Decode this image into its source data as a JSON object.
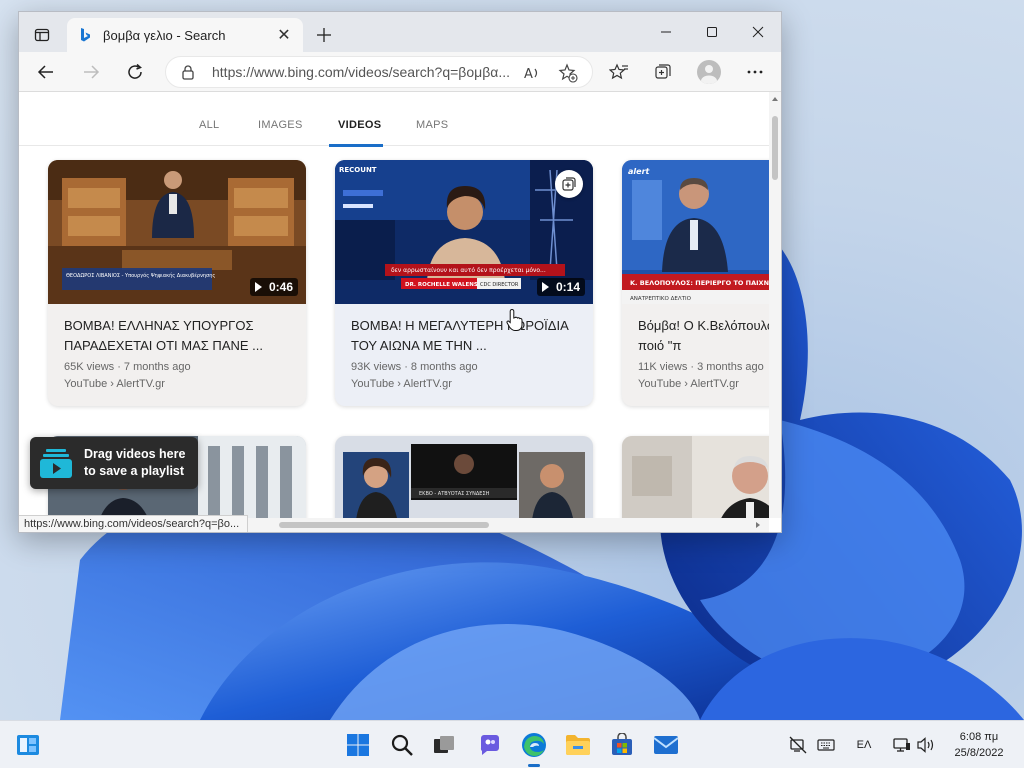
{
  "tab": {
    "title": "βομβα γελιο - Search",
    "close_glyph": "✕"
  },
  "toolbar": {
    "url": "https://www.bing.com/videos/search?q=βομβα..."
  },
  "scope_tabs": [
    {
      "label": "ALL"
    },
    {
      "label": "IMAGES"
    },
    {
      "label": "VIDEOS",
      "active": true
    },
    {
      "label": "MAPS"
    }
  ],
  "cards": [
    {
      "duration": "0:46",
      "title": "ΒΟΜΒΑ! ΕΛΛΗΝΑΣ ΥΠΟΥΡΓΟΣ ΠΑΡΑΔΕΧΕΤΑΙ ΟΤΙ ΜΑΣ ΠΑΝΕ ...",
      "views": "65K views · 7 months ago",
      "source": "YouTube › AlertTV.gr"
    },
    {
      "duration": "0:14",
      "title": "ΒΟΜΒΑ! Η ΜΕΓΑΛΥΤΕΡΗ ΚΩΡΟΪΔΙΑ ΤΟΥ ΑΙΩΝΑ ΜΕ ΤΗΝ ...",
      "views": "93K views · 8 months ago",
      "source": "YouTube › AlertTV.gr"
    },
    {
      "title": "Βόμβα! Ο Κ.Βελόπουλος αποκαλύπτει ποιό \"π",
      "views": "11K views · 3 months ago",
      "source": "YouTube › AlertTV.gr"
    }
  ],
  "thumb_captions": {
    "c1": "ΘΕΟΔΩΡΟΣ ΛΙΒΑΝΙΟΣ - Υπουργός Ψηφιακής Διακυβέρνησης",
    "c2_ticker": "δεν αρρωσταίνουν και αυτό δεν προέρχεται μόνο...",
    "c2_name": "DR. ROCHELLE WALENSKY",
    "c2_role": "CDC DIRECTOR",
    "c2_brand": "RECOUNT",
    "c3_brand": "alert",
    "c3_banner": "Κ. ΒΕΛΟΠΟΥΛΟΣ: ΠΕΡΙΕΡΓΟ ΤΟ ΠΑΙΧΝΙΔΙ ΠΟ",
    "c3_sub": "ΑΝΑΤΡΕΠΤΙΚΟ ΔΕΛΤΙΟ",
    "c5_strip": "ΕΚΒΟ - ΑΤΒΥΟΤΑΣ ΣΥΝΔΕΣΗ"
  },
  "playlist_hint": {
    "line1": "Drag videos here",
    "line2": "to save a playlist"
  },
  "status_bar": {
    "url": "https://www.bing.com/videos/search?q=βο..."
  },
  "taskbar": {
    "language": "ΕΛ",
    "time": "6:08 πμ",
    "date": "25/8/2022"
  },
  "colors": {
    "accent": "#1a6ec8",
    "edge_blue": "#0c7ad8",
    "wallpaper_blue": "#1c55d0"
  },
  "icons": [
    "tab-actions-icon",
    "bing-icon",
    "lock-icon",
    "read-aloud-icon",
    "add-favorite-icon",
    "favorites-icon",
    "collections-icon",
    "menu-icon",
    "add-to-collection-icon",
    "playlist-icon",
    "windows-start-icon",
    "search-icon",
    "task-view-icon",
    "chat-icon",
    "edge-icon",
    "file-explorer-icon",
    "store-icon",
    "mail-icon",
    "network-off-icon",
    "keyboard-icon",
    "monitor-icon",
    "volume-icon",
    "widgets-icon"
  ]
}
